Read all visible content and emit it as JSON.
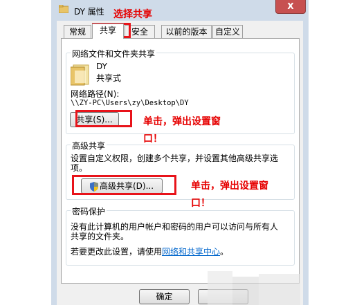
{
  "window": {
    "title": "DY 属性",
    "close_label": "X"
  },
  "tabs": [
    {
      "label": "常规",
      "active": false
    },
    {
      "label": "共享",
      "active": true
    },
    {
      "label": "安全",
      "active": false
    },
    {
      "label": "以前的版本",
      "active": false
    },
    {
      "label": "自定义",
      "active": false
    }
  ],
  "network_share": {
    "group_title": "网络文件和文件夹共享",
    "folder_name": "DY",
    "folder_status": "共享式",
    "path_label": "网络路径(N):",
    "path_value": "\\\\ZY-PC\\Users\\zy\\Desktop\\DY",
    "share_button": "共享(S)..."
  },
  "advanced_share": {
    "group_title": "高级共享",
    "description_line1": "设置自定义权限，创建多个共享，并设置其他高级共享选",
    "description_line2": "项。",
    "button": "高级共享(D)..."
  },
  "password": {
    "group_title": "密码保护",
    "line1": "没有此计算机的用户帐户和密码的用户可以访问与所有人",
    "line2": "共享的文件夹。",
    "change_prefix": "若要更改此设置，请使用",
    "change_link": "网络和共享中心",
    "change_suffix": "。"
  },
  "footer": {
    "ok_button": "确定"
  },
  "annotations": {
    "select_share": "选择共享",
    "click_popup_1_line1": "单击，弹出设置窗",
    "click_popup_1_line2": "口！",
    "click_popup_2_line1": "单击，弹出设置窗",
    "click_popup_2_line2": "口！",
    "annotation_color": "#e60000"
  }
}
